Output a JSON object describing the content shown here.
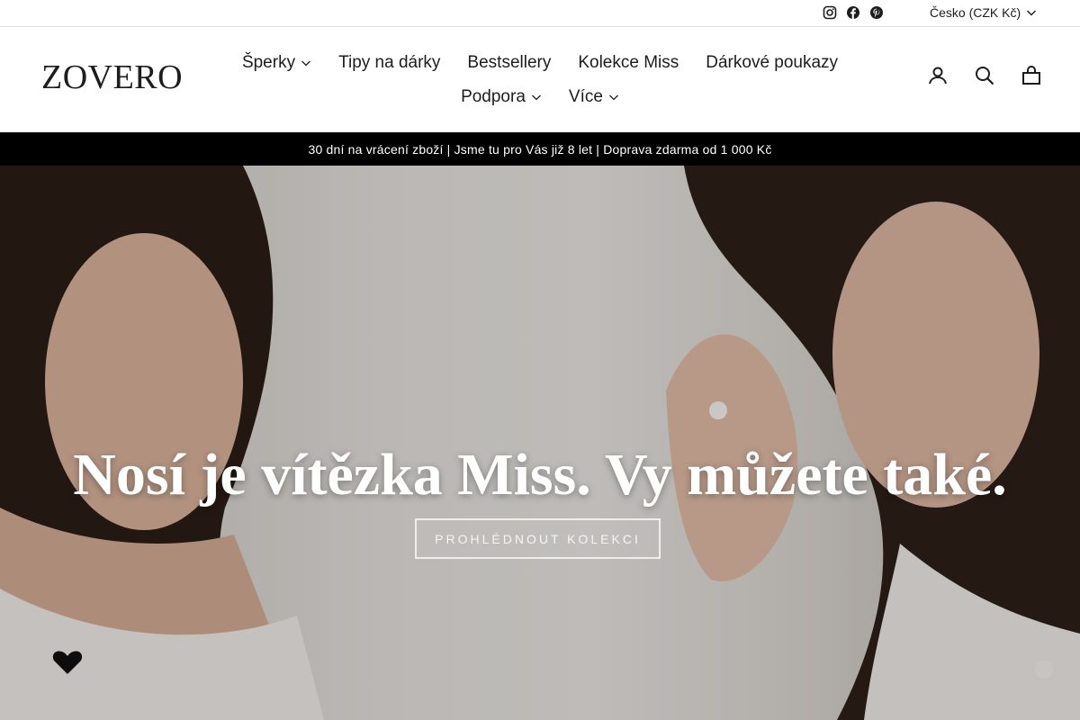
{
  "utility": {
    "social_icons": [
      "instagram-icon",
      "facebook-icon",
      "pinterest-icon"
    ],
    "currency_label": "Česko (CZK Kč)"
  },
  "header": {
    "logo": "ZOVERO",
    "nav_row1": [
      {
        "label": "Šperky",
        "dropdown": true
      },
      {
        "label": "Tipy na dárky",
        "dropdown": false
      },
      {
        "label": "Bestsellery",
        "dropdown": false
      },
      {
        "label": "Kolekce Miss",
        "dropdown": false
      },
      {
        "label": "Dárkové poukazy",
        "dropdown": false
      }
    ],
    "nav_row2": [
      {
        "label": "Podpora",
        "dropdown": true
      },
      {
        "label": "Více",
        "dropdown": true
      }
    ],
    "icons": [
      "user-icon",
      "search-icon",
      "cart-icon"
    ]
  },
  "announcement": {
    "text": "30 dní na vrácení zboží | Jsme tu pro Vás již 8 let | Doprava zdarma od 1 000 Kč"
  },
  "hero": {
    "title": "Nosí je vítězka Miss. Vy můžete také.",
    "button_label": "PROHLÉDNOUT KOLEKCI"
  },
  "colors": {
    "text": "#1c1d1d",
    "announcement_bg": "#000000",
    "hero_text": "#ffffff"
  }
}
